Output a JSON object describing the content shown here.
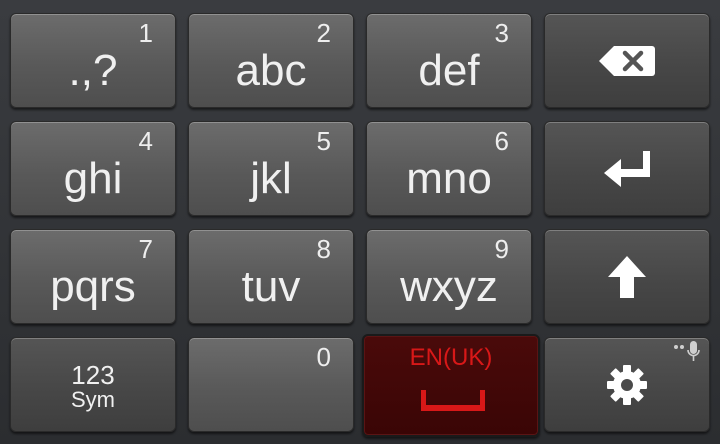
{
  "keyboard": {
    "rows": [
      [
        {
          "number": "1",
          "letters": ".,?"
        },
        {
          "number": "2",
          "letters": "abc"
        },
        {
          "number": "3",
          "letters": "def"
        },
        {
          "icon": "backspace-icon"
        }
      ],
      [
        {
          "number": "4",
          "letters": "ghi"
        },
        {
          "number": "5",
          "letters": "jkl"
        },
        {
          "number": "6",
          "letters": "mno"
        },
        {
          "icon": "enter-icon"
        }
      ],
      [
        {
          "number": "7",
          "letters": "pqrs"
        },
        {
          "number": "8",
          "letters": "tuv"
        },
        {
          "number": "9",
          "letters": "wxyz"
        },
        {
          "icon": "shift-arrow-icon"
        }
      ]
    ],
    "mode_key": {
      "line1": "123",
      "line2": "Sym"
    },
    "zero_key": {
      "number": "0"
    },
    "space_key": {
      "language": "EN(UK)",
      "icon": "space-bar-icon"
    },
    "settings_key": {
      "icon": "gear-icon",
      "secondary_icon": "microphone-icon"
    }
  },
  "colors": {
    "key_face": "#5e5e5e",
    "space_face": "#3f0707",
    "space_text": "#d81818",
    "text": "#f0f0f0"
  }
}
